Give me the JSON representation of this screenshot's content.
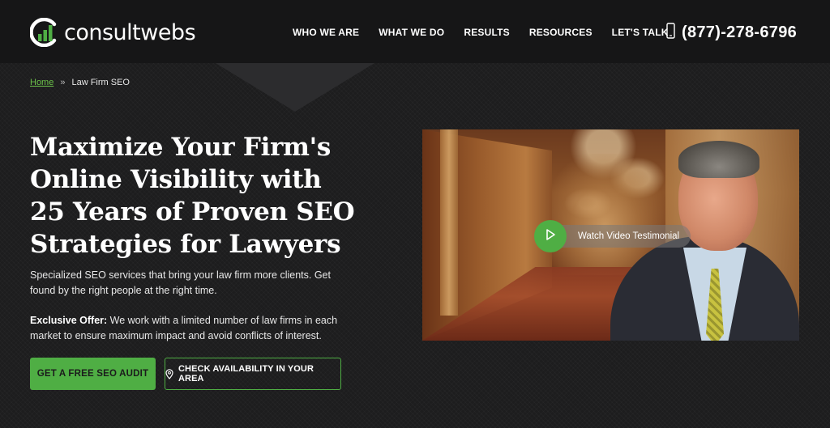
{
  "header": {
    "logo_text": "consultwebs",
    "nav": [
      {
        "label": "WHO WE ARE"
      },
      {
        "label": "WHAT WE DO"
      },
      {
        "label": "RESULTS"
      },
      {
        "label": "RESOURCES"
      },
      {
        "label": "LET'S TALK"
      }
    ],
    "phone": "(877)-278-6796",
    "phone_icon": "phone-icon"
  },
  "breadcrumb": {
    "home": "Home",
    "separator": "»",
    "current": "Law Firm SEO"
  },
  "hero": {
    "headline_lines": [
      "Maximize Your Firm's",
      "Online Visibility with",
      "25 Years of Proven SEO",
      "Strategies for Lawyers"
    ],
    "subtext": "Specialized SEO services that bring your law firm more clients. Get found by the right people at the right time.",
    "offer_label": "Exclusive Offer:",
    "offer_text": " We work with a limited number of law firms in each market to ensure maximum impact and avoid conflicts of interest.",
    "primary_cta": "GET A FREE SEO AUDIT",
    "secondary_cta": "CHECK AVAILABILITY IN YOUR AREA",
    "secondary_icon": "map-pin-icon"
  },
  "video": {
    "play_label": "Watch Video Testimonial",
    "play_icon": "play-icon"
  },
  "colors": {
    "accent": "#4fae44",
    "header_bg": "#161617",
    "page_bg": "#1d1d1e"
  }
}
